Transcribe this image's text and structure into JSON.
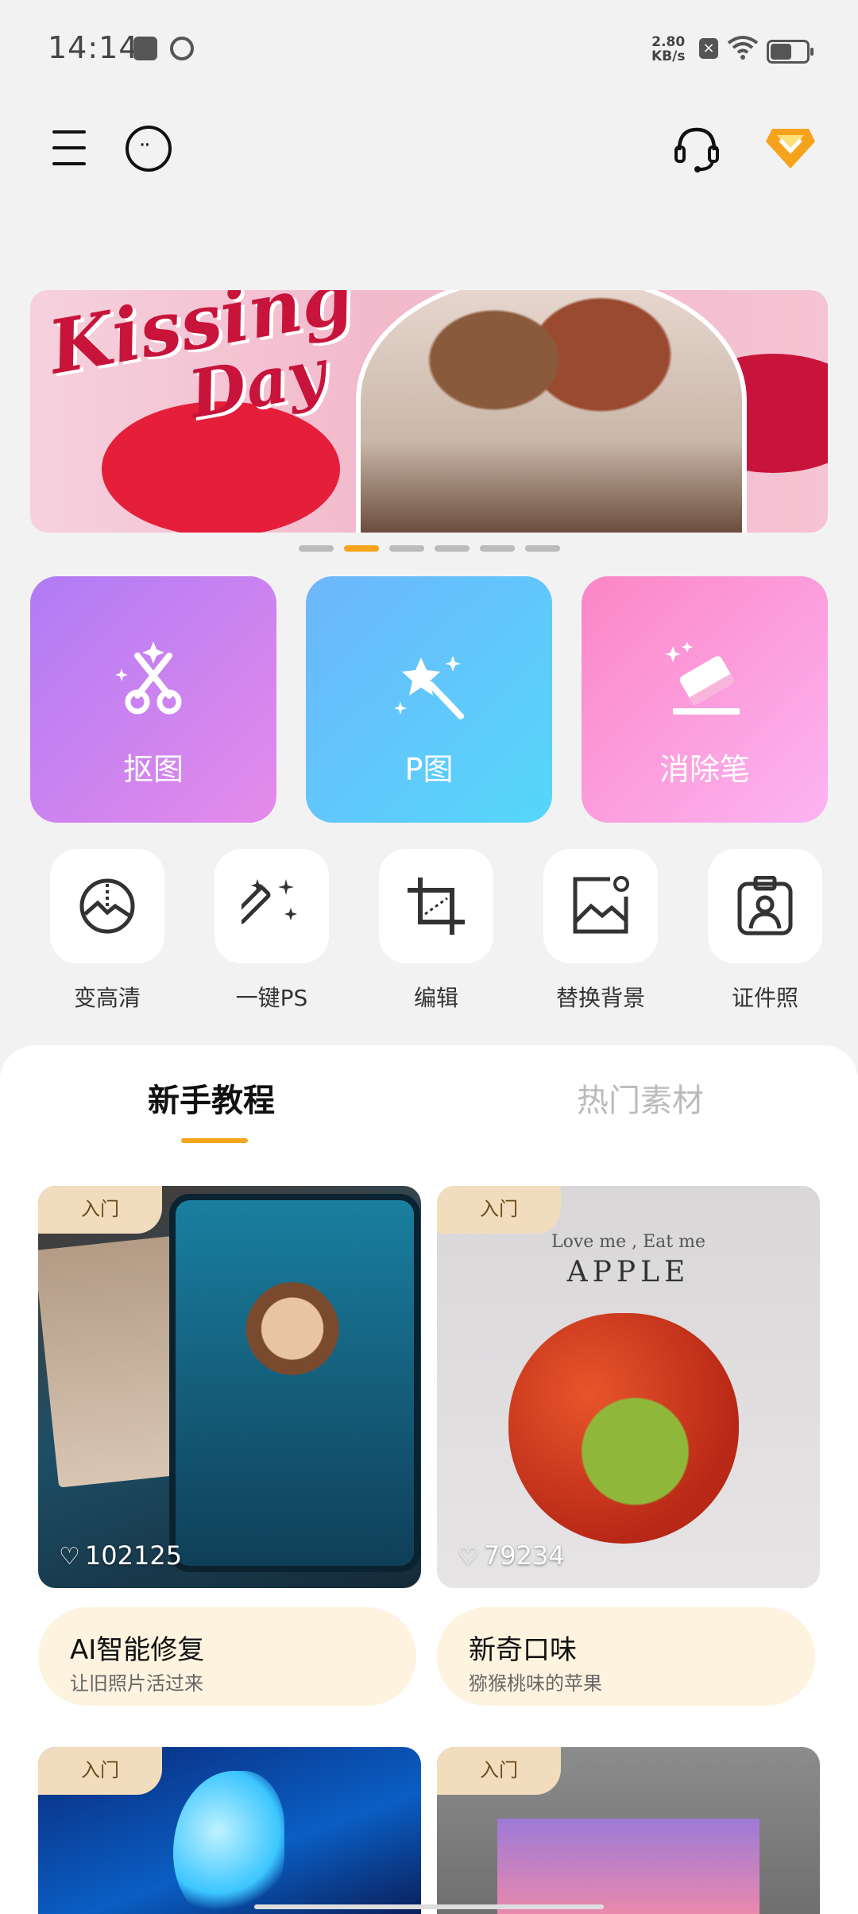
{
  "status": {
    "time": "14:14",
    "net_speed_value": "2.80",
    "net_speed_unit": "KB/s",
    "battery_percent": 60
  },
  "banner": {
    "title_line1": "Kissing",
    "title_line2": "Day",
    "active_slide": 2,
    "slide_count": 6
  },
  "big_tools": [
    {
      "label": "抠图",
      "icon": "scissors-icon"
    },
    {
      "label": "P图",
      "icon": "magic-wand-icon"
    },
    {
      "label": "消除笔",
      "icon": "eraser-icon"
    }
  ],
  "small_tools": [
    {
      "label": "变高清",
      "icon": "hd-enhance-icon"
    },
    {
      "label": "一键PS",
      "icon": "wand-sparkle-icon"
    },
    {
      "label": "编辑",
      "icon": "crop-icon"
    },
    {
      "label": "替换背景",
      "icon": "image-replace-icon"
    },
    {
      "label": "证件照",
      "icon": "id-photo-icon"
    }
  ],
  "tabs": {
    "active": "新手教程",
    "inactive": "热门素材"
  },
  "cards": [
    {
      "badge": "入门",
      "likes": "102125",
      "title": "AI智能修复",
      "subtitle": "让旧照片活过来"
    },
    {
      "badge": "入门",
      "likes": "79234",
      "title": "新奇口味",
      "subtitle": "猕猴桃味的苹果",
      "overlay_line1": "Love me , Eat me",
      "overlay_line2": "APPLE"
    },
    {
      "badge": "入门"
    },
    {
      "badge": "入门"
    }
  ],
  "colors": {
    "accent": "#f5a51b",
    "koutu_gradient": [
      "#b07bf5",
      "#e58bea"
    ],
    "ptu_gradient": [
      "#6db6fb",
      "#55d7fb"
    ],
    "eraser_gradient": [
      "#fb86c6",
      "#fdb4f2"
    ]
  }
}
